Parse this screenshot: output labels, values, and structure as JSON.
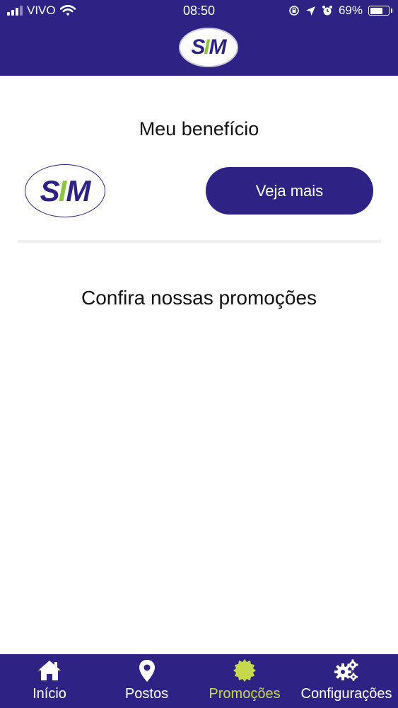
{
  "status_bar": {
    "carrier": "VIVO",
    "time": "08:50",
    "battery": "69%",
    "battery_level": 0.69,
    "icons": [
      "signal-bars-icon",
      "wifi-icon",
      "rotation-lock-icon",
      "location-arrow-icon",
      "alarm-clock-icon",
      "battery-icon"
    ]
  },
  "header": {
    "logo": {
      "letter_s": "S",
      "letter_i": "I",
      "letter_m": "M"
    }
  },
  "main": {
    "benefit_title": "Meu benefício",
    "benefit_logo": {
      "letter_s": "S",
      "letter_i": "I",
      "letter_m": "M"
    },
    "see_more_label": "Veja mais",
    "promotions_title": "Confira nossas promoções"
  },
  "tabs": [
    {
      "label": "Início",
      "icon": "home-icon",
      "active": false
    },
    {
      "label": "Postos",
      "icon": "map-pin-icon",
      "active": false
    },
    {
      "label": "Promoções",
      "icon": "promo-badge-icon",
      "active": true
    },
    {
      "label": "Configurações",
      "icon": "gears-icon",
      "active": false
    }
  ],
  "colors": {
    "brand_primary": "#2e2384",
    "brand_accent": "#8cc63f",
    "active_tab": "#c6d94c",
    "background": "#ffffff"
  }
}
